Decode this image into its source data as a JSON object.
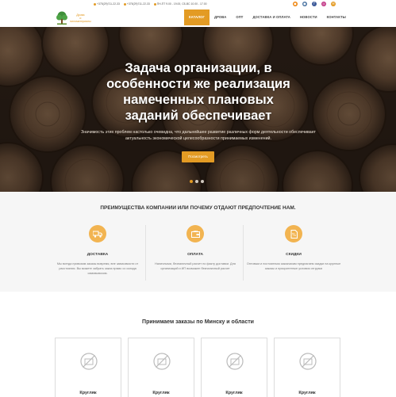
{
  "topbar": {
    "phone1": "+375(29)711-22-33",
    "phone2": "+375(29)711-22-33",
    "hours": "ПН-ПТ 9.00 - 19.00, СБ-ВС 10.00 - 17.00",
    "socials": [
      "ok-icon",
      "vk-icon",
      "facebook-icon",
      "instagram-icon",
      "mail-icon"
    ],
    "social_glyphs": [
      "●",
      "●",
      "f",
      "◎",
      "✉"
    ]
  },
  "logo": {
    "line1": "Дрова",
    "line2": "и",
    "line3": "пиломатериалы"
  },
  "nav": {
    "items": [
      "КАТАЛОГ",
      "ДРОВА",
      "ОПТ",
      "ДОСТАВКА И ОПЛАТА",
      "НОВОСТИ",
      "КОНТАКТЫ"
    ],
    "active_index": 0
  },
  "hero": {
    "title": "Задача организации, в особенности же реализация намеченных плановых заданий обеспечивает",
    "subtitle": "Значимость этих проблем настолько очевидна, что дальнейшее развитие различных форм деятельности обеспечивает актуальность экономической целесообразности принимаемых изменений.",
    "button": "Посмотреть",
    "slides": 3,
    "active_slide": 0
  },
  "features": {
    "title": "ПРЕИМУЩЕСТВА КОМПАНИИ ИЛИ ПОЧЕМУ ОТДАЮТ ПРЕДПОЧТЕНИЕ НАМ.",
    "items": [
      {
        "name": "ДОСТАВКА",
        "desc": "Мы всегда привозим заказы вовремя, вне зависимости от расстояния. Вы можете забрать заказ прямо со склада самовывозом.",
        "icon": "truck-icon"
      },
      {
        "name": "ОПЛАТА",
        "desc": "Наличными, безналичный расчет по факту доставки. Для организаций и ИП возможен безналичный расчет",
        "icon": "wallet-icon"
      },
      {
        "name": "СКИДКИ",
        "desc": "Оптовым и постоянным заказчикам предлагаем скидки на крупные заказы и приоритетные условия отгрузки",
        "icon": "discount-tag-icon"
      }
    ]
  },
  "products": {
    "title": "Принимаем заказы по Минску и области",
    "items": [
      "Кругляк",
      "Кругляк",
      "Кругляк",
      "Кругляк"
    ]
  },
  "colors": {
    "accent": "#e39b24",
    "accent_light": "#f2b451",
    "hero_bg": "#3a2a1e"
  }
}
